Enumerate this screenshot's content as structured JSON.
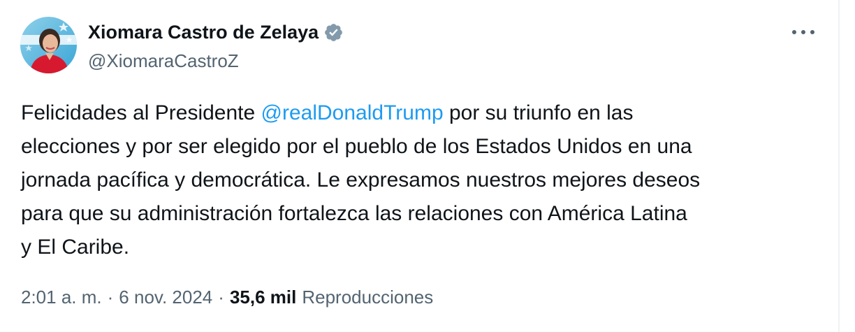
{
  "author": {
    "display_name": "Xiomara Castro de Zelaya",
    "handle": "@XiomaraCastroZ",
    "verified_icon": "verified-badge-icon",
    "verified_color": "#829aab"
  },
  "menu": {
    "icon": "more-horizontal-icon"
  },
  "tweet": {
    "lines": [
      {
        "before": "Felicidades al Presidente ",
        "mention": "@realDonaldTrump",
        "after": " por su triunfo en las"
      },
      {
        "text": "elecciones y por ser elegido por el pueblo de los Estados Unidos en una"
      },
      {
        "text": "jornada pacífica y democrática. Le expresamos nuestros mejores deseos"
      },
      {
        "text": "para que su administración fortalezca las relaciones con América Latina"
      },
      {
        "text": "y El Caribe."
      }
    ]
  },
  "meta": {
    "time": "2:01 a. m.",
    "separator": "·",
    "date": "6 nov. 2024",
    "views_count": "35,6 mil",
    "views_label": "Reproducciones"
  },
  "colors": {
    "text": "#0f1419",
    "secondary": "#536471",
    "link": "#1d9bf0"
  }
}
